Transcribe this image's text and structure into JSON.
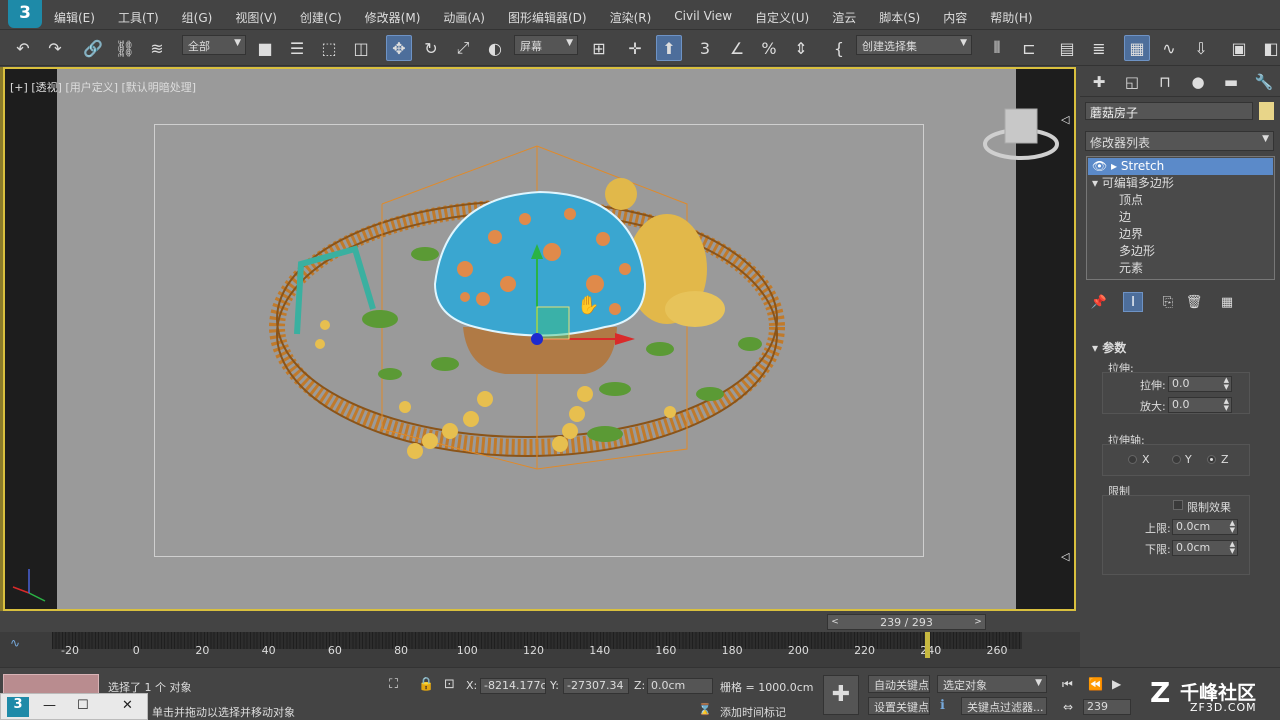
{
  "app": {
    "logo_text": "3"
  },
  "menu": [
    "编辑(E)",
    "工具(T)",
    "组(G)",
    "视图(V)",
    "创建(C)",
    "修改器(M)",
    "动画(A)",
    "图形编辑器(D)",
    "渲染(R)",
    "Civil View",
    "自定义(U)",
    "脚本(S)",
    "内容",
    "帮助(H)"
  ],
  "menu_extra": "渲云",
  "toolbar": {
    "selection_filter": "全部",
    "ref_coord": "屏幕",
    "named_selection": "创建选择集"
  },
  "viewport": {
    "label_plus": "[+]",
    "label_view": "[透视]",
    "label_shading": "[用户定义]",
    "label_lighting": "[默认明暗处理]"
  },
  "command_panel": {
    "object_name": "蘑菇房子",
    "object_color": "#e8d589",
    "modifier_list": "修改器列表",
    "stack": [
      {
        "label": "Stretch",
        "selected": true
      },
      {
        "label": "可编辑多边形",
        "selected": false
      },
      {
        "label": "顶点",
        "selected": false
      },
      {
        "label": "边",
        "selected": false
      },
      {
        "label": "边界",
        "selected": false
      },
      {
        "label": "多边形",
        "selected": false
      },
      {
        "label": "元素",
        "selected": false
      }
    ],
    "params": {
      "title": "参数",
      "stretch_group": "拉伸:",
      "stretch_label": "拉伸:",
      "stretch_value": "0.0",
      "amplify_label": "放大:",
      "amplify_value": "0.0",
      "axis_group": "拉伸轴:",
      "axis_x": "X",
      "axis_y": "Y",
      "axis_z": "Z",
      "limit_group": "限制",
      "limit_effect": "限制效果",
      "upper_label": "上限:",
      "upper_value": "0.0cm",
      "lower_label": "下限:",
      "lower_value": "0.0cm"
    }
  },
  "time_slider": {
    "value": "239 / 293",
    "prev": "<",
    "next": ">"
  },
  "timeline": {
    "ticks": [
      "-20",
      "0",
      "20",
      "40",
      "60",
      "80",
      "100",
      "120",
      "140",
      "160",
      "180",
      "200",
      "220",
      "240",
      "260"
    ],
    "current_frame": 239
  },
  "status": {
    "selected_text": "选择了 1 个 对象",
    "prompt_text": "单击并拖动以选择并移动对象",
    "x_label": "X:",
    "x_value": "-8214.177c",
    "y_label": "Y:",
    "y_value": "-27307.34",
    "z_label": "Z:",
    "z_value": "0.0cm",
    "grid_text": "栅格 = 1000.0cm",
    "add_time_tag": "添加时间标记",
    "auto_key": "自动关键点",
    "set_key": "设置关键点",
    "selected_object": "选定对象",
    "key_filter": "关键点过滤器...",
    "frame_value": "239"
  },
  "taskbar": {
    "icon": "3"
  },
  "watermark": {
    "text": "千峰社区",
    "sub": "ZF3D.COM"
  }
}
